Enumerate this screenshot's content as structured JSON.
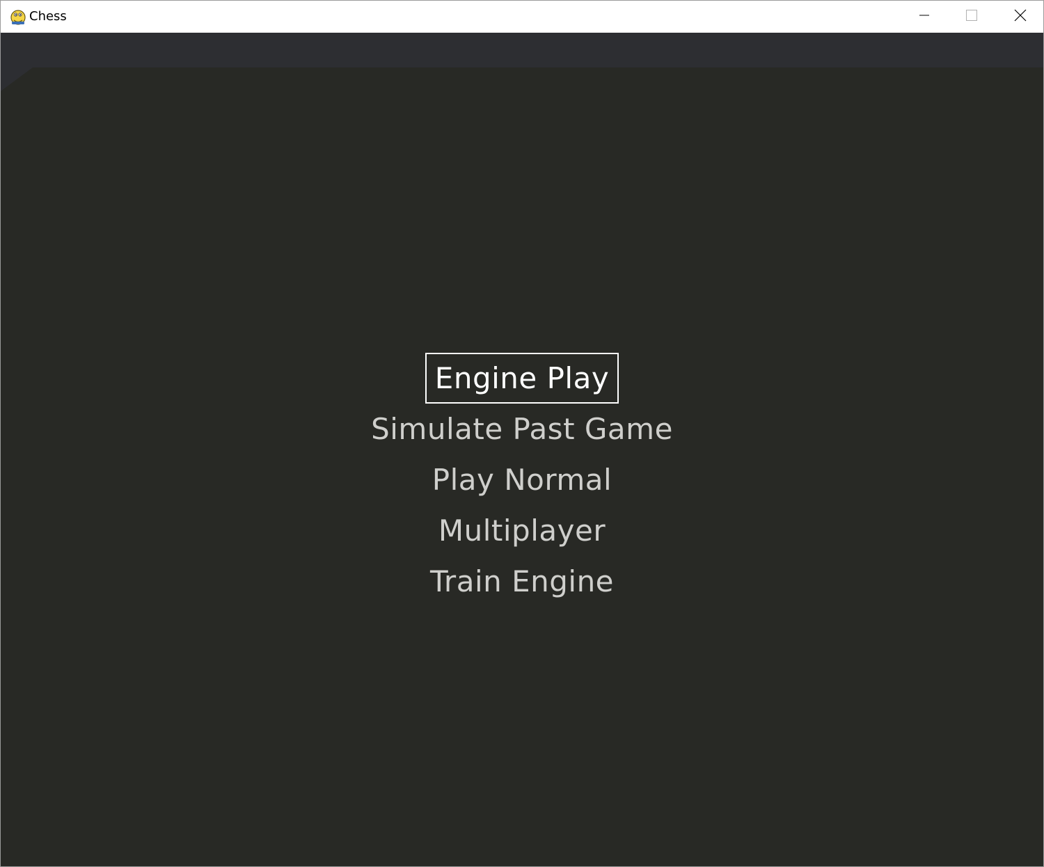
{
  "window": {
    "title": "Chess",
    "icon": "pygame-snake-icon",
    "controls": {
      "minimize": "minimize-icon",
      "maximize": "maximize-icon",
      "close": "close-icon"
    }
  },
  "colors": {
    "client_background": "#282925",
    "top_band": "#2d2e32",
    "menu_text": "#cfcfcc",
    "menu_selected_text": "#ffffff"
  },
  "menu": {
    "items": [
      {
        "label": "Engine Play",
        "selected": true
      },
      {
        "label": "Simulate Past Game",
        "selected": false
      },
      {
        "label": "Play Normal",
        "selected": false
      },
      {
        "label": "Multiplayer",
        "selected": false
      },
      {
        "label": "Train Engine",
        "selected": false
      }
    ]
  }
}
